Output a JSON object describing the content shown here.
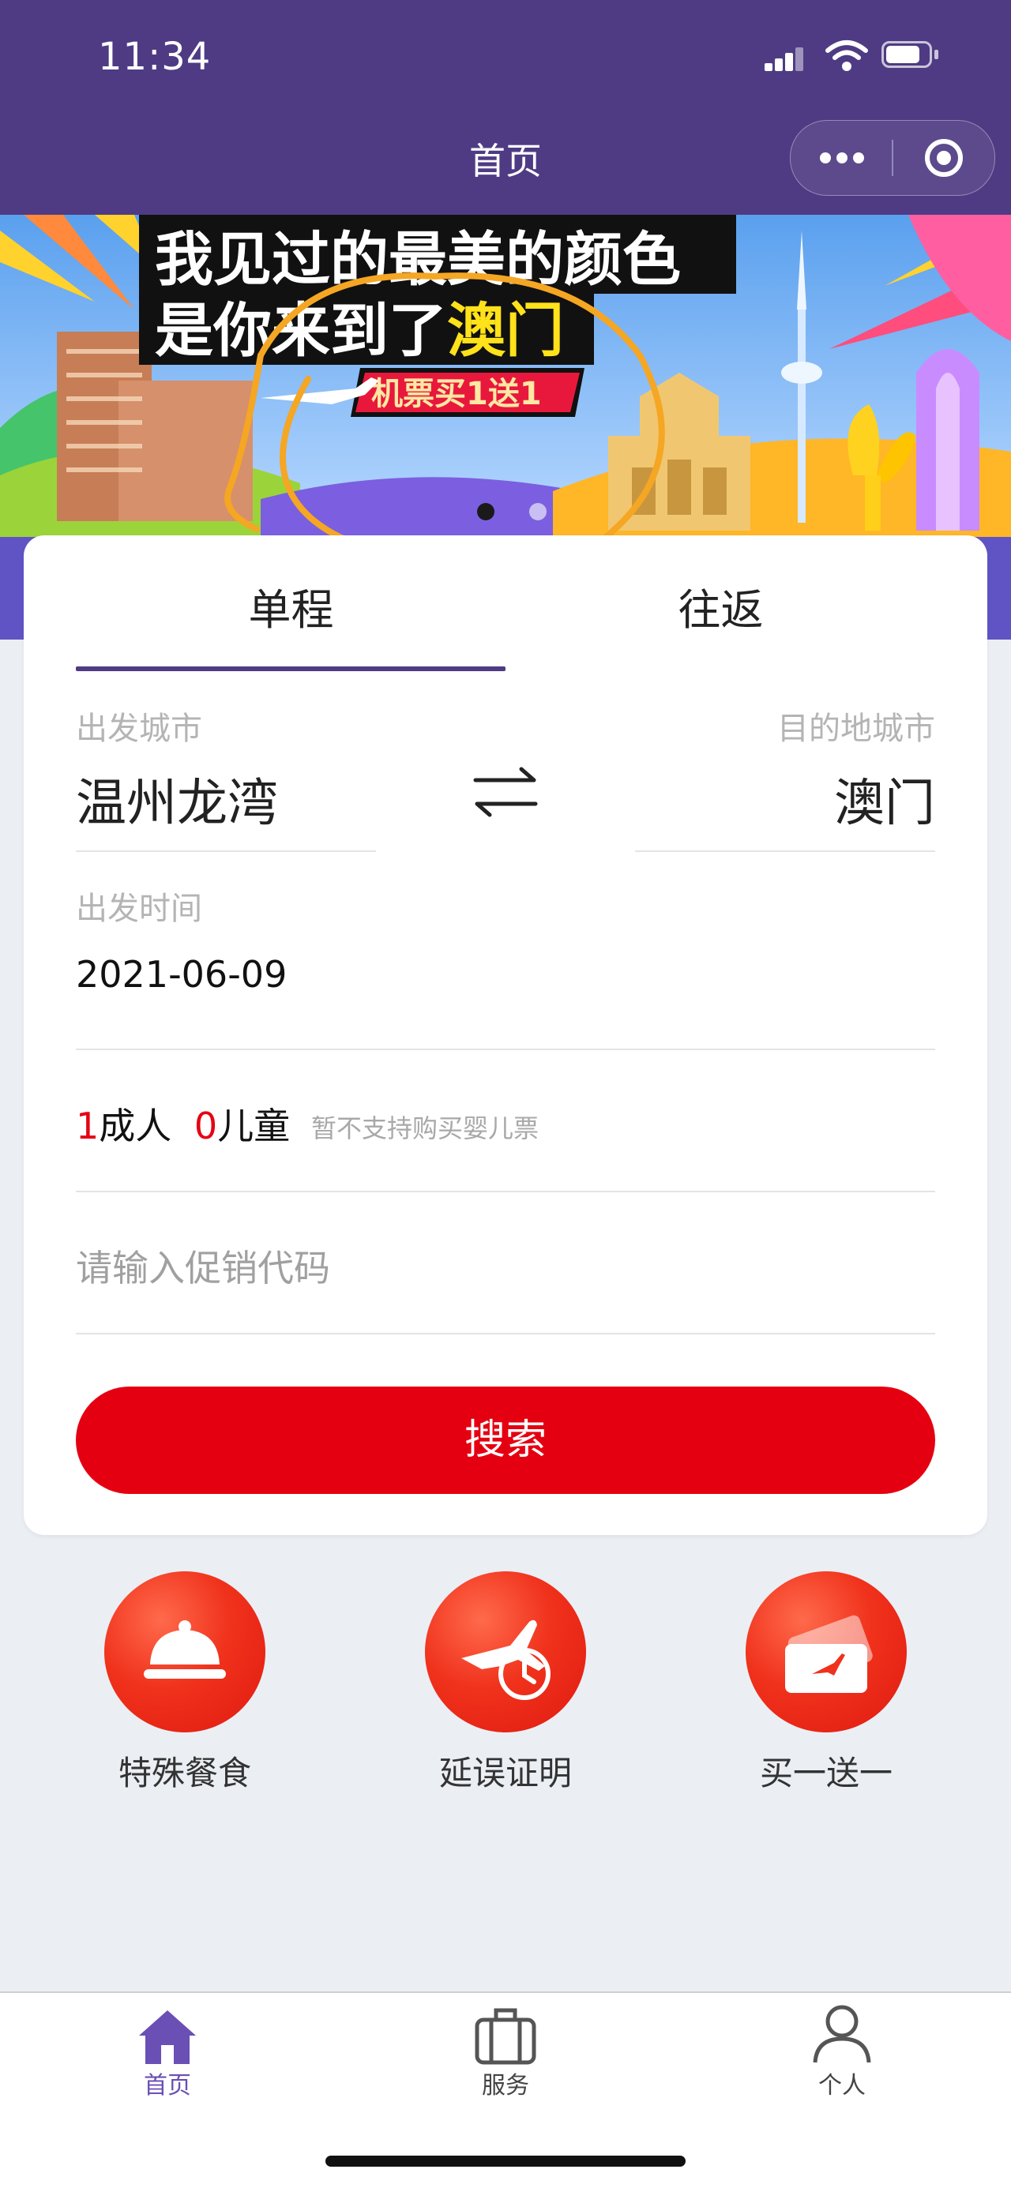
{
  "status_bar": {
    "time": "11:34"
  },
  "nav": {
    "title": "首页"
  },
  "banner": {
    "headline_line1": "我见过的最美的颜色",
    "headline_line2_prefix": "是你来到了",
    "headline_line2_highlight": "澳门",
    "promo_tag": "机票买1送1",
    "page_count": 2,
    "active_page": 1
  },
  "booking": {
    "tabs": [
      "单程",
      "往返"
    ],
    "active_tab": "单程",
    "departure_label": "出发城市",
    "departure_city": "温州龙湾",
    "destination_label": "目的地城市",
    "destination_city": "澳门",
    "date_label": "出发时间",
    "date_value": "2021-06-09",
    "adults_count": "1",
    "adults_label": "成人",
    "children_count": "0",
    "children_label": "儿童",
    "infant_note": "暂不支持购买婴儿票",
    "promo_placeholder": "请输入促销代码",
    "search_label": "搜索"
  },
  "services": [
    {
      "label": "特殊餐食",
      "icon": "cloche-icon"
    },
    {
      "label": "延误证明",
      "icon": "plane-clock-icon"
    },
    {
      "label": "买一送一",
      "icon": "ticket-icon"
    }
  ],
  "tabbar": [
    {
      "label": "首页",
      "icon": "home-icon",
      "active": true
    },
    {
      "label": "服务",
      "icon": "luggage-icon",
      "active": false
    },
    {
      "label": "个人",
      "icon": "user-icon",
      "active": false
    }
  ],
  "colors": {
    "header_bg": "#4f3b84",
    "accent_red": "#e50011",
    "active_tab": "#6a4fb4",
    "annotation": "#f5a623"
  }
}
